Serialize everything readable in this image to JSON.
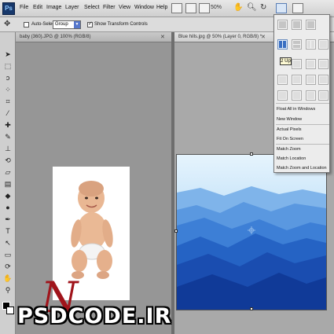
{
  "app": {
    "logo": "Ps"
  },
  "menu": [
    "File",
    "Edit",
    "Image",
    "Layer",
    "Select",
    "Filter",
    "View",
    "Window",
    "Help"
  ],
  "zoom": "50%",
  "options_bar": {
    "auto_select_label": "Auto-Select:",
    "auto_select_value": "Group",
    "show_transform_label": "Show Transform Controls"
  },
  "documents": [
    {
      "title": "baby (360).JPG @ 100% (RGB/8)",
      "state": "inactive"
    },
    {
      "title": "Blue hills.jpg @ 50% (Layer 0, RGB/8) *",
      "state": "active"
    }
  ],
  "arrange_panel": {
    "tooltip": "2 Up",
    "items": [
      "Float All in Windows",
      "New Window",
      "Actual Pixels",
      "Fit On Screen",
      "Match Zoom",
      "Match Location",
      "Match Zoom and Location"
    ]
  },
  "watermark": {
    "brand": "PSDCODE.IR",
    "initial": "N"
  },
  "colors": {
    "foreground": "#000000",
    "background": "#ffffff",
    "hills_sky": "#cfe7fb",
    "hills_dark": "#0a3aa0"
  }
}
